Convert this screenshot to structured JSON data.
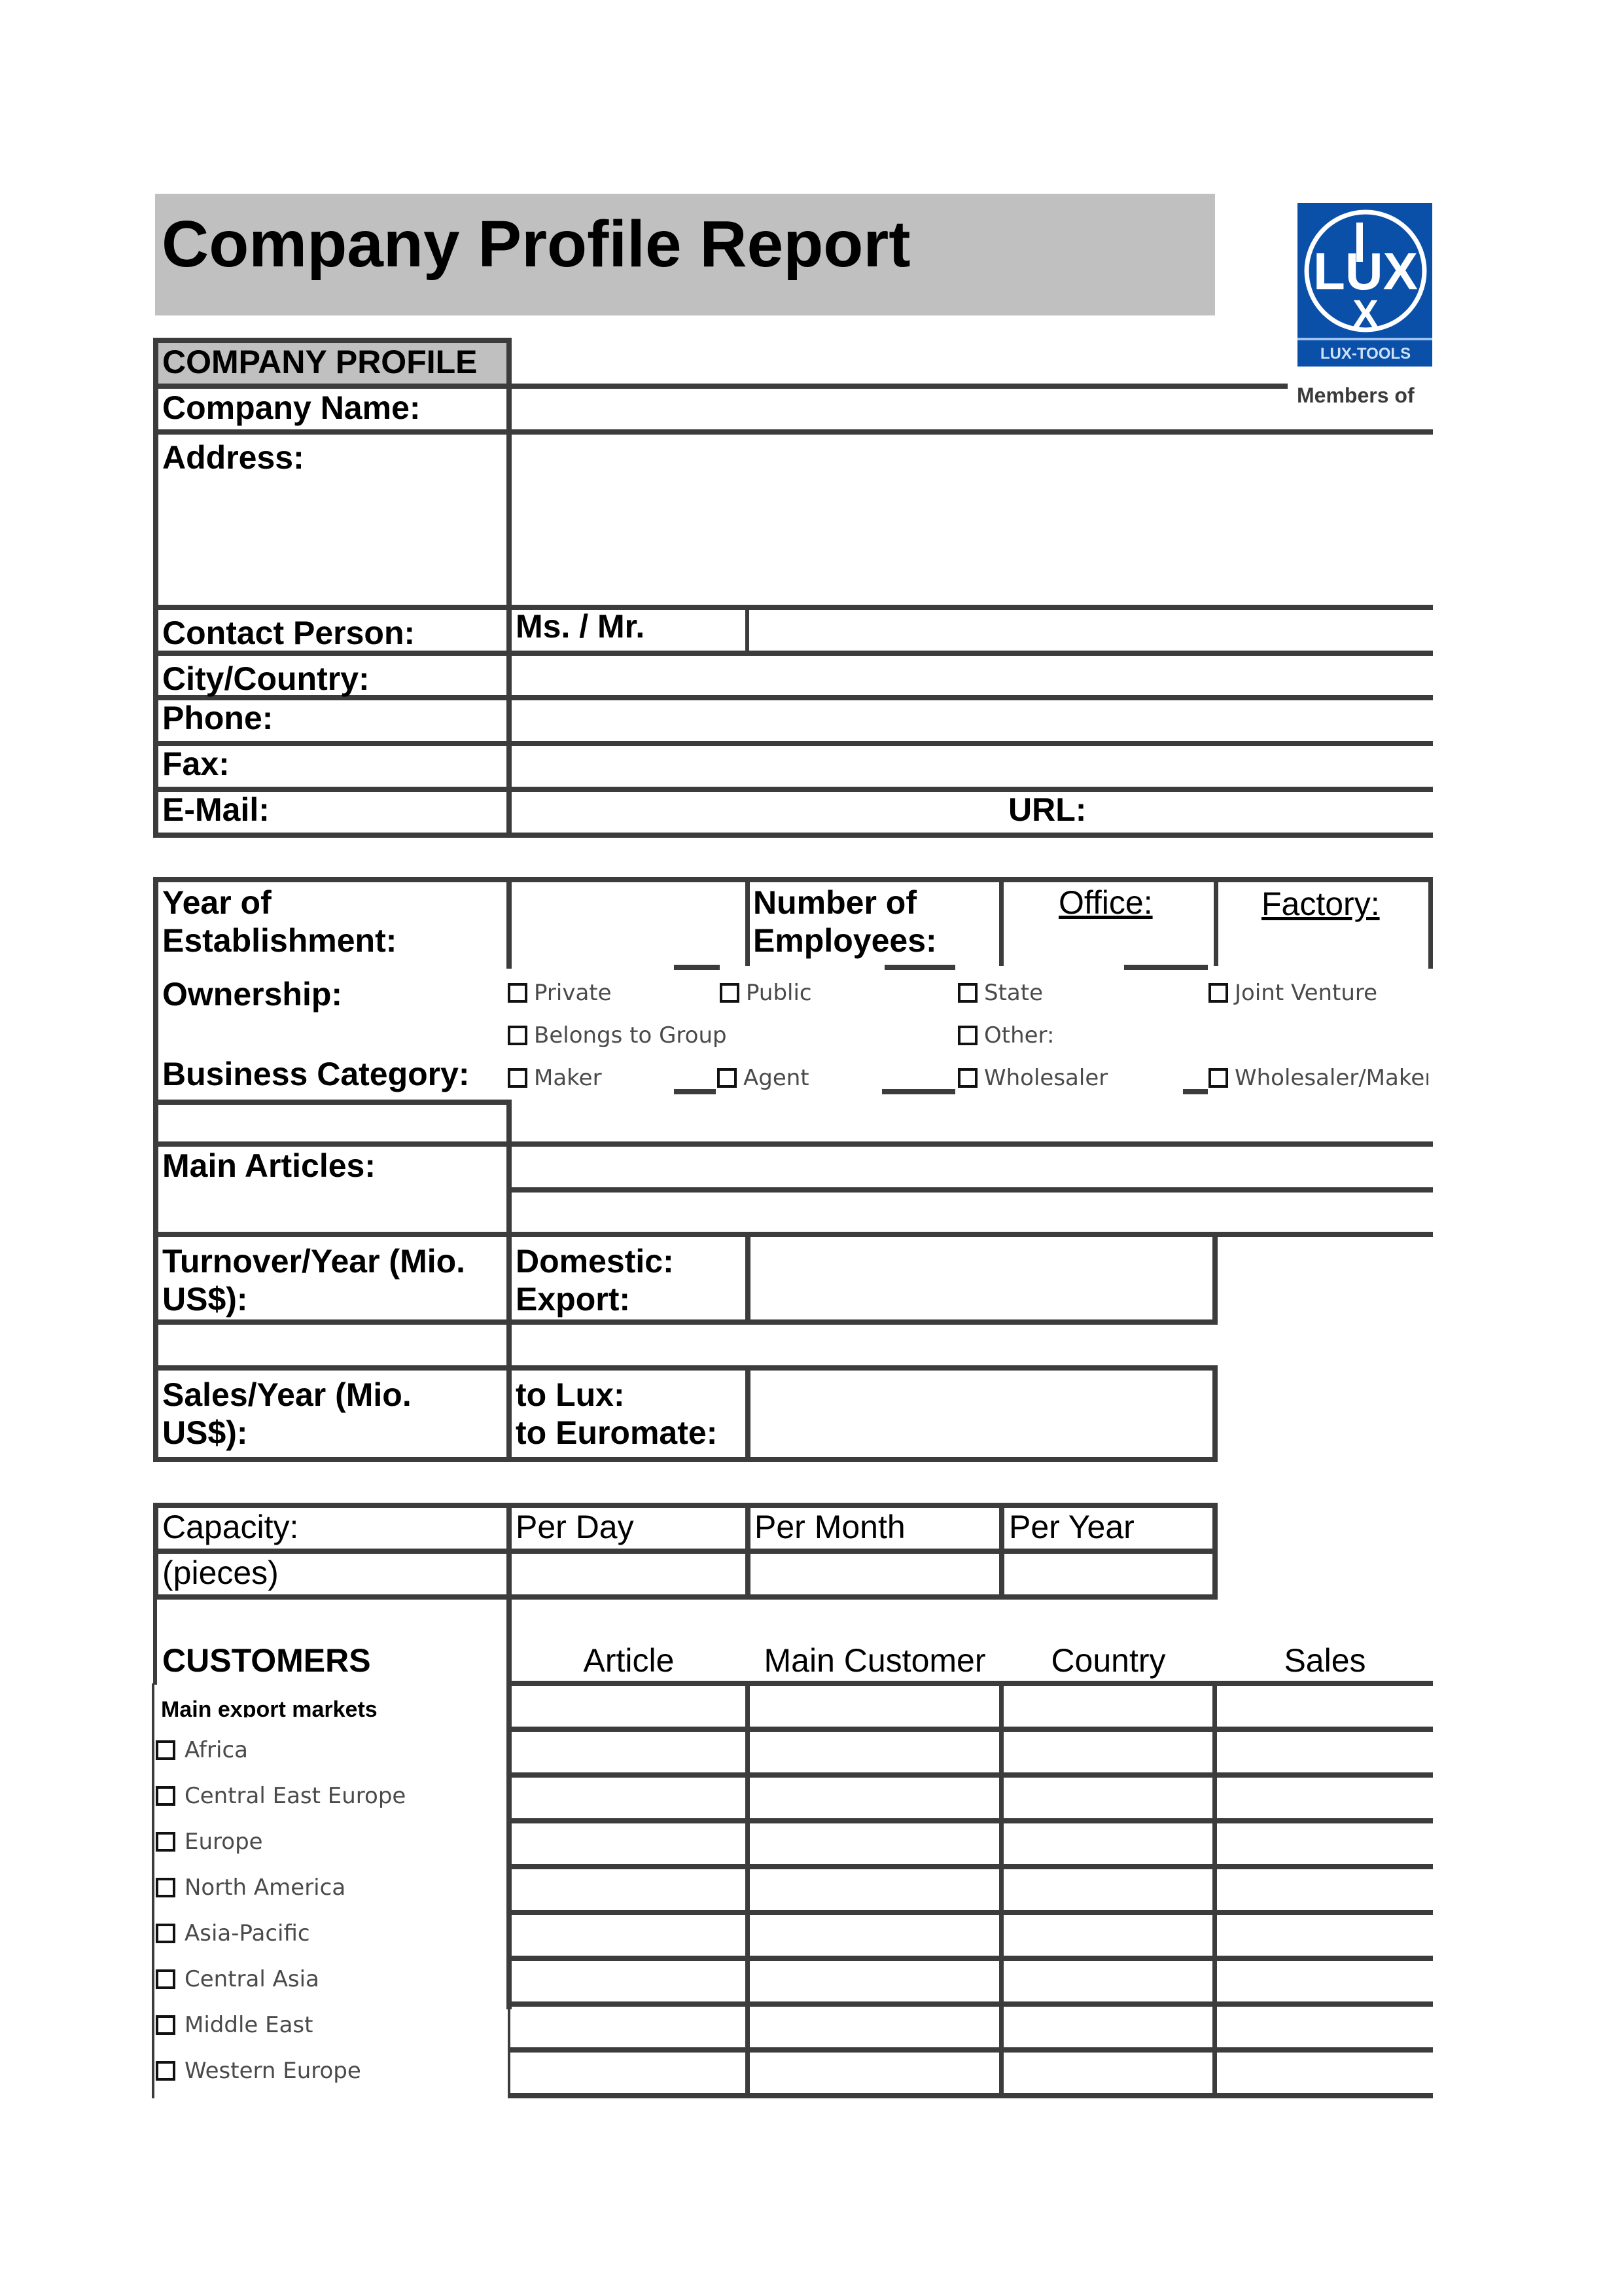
{
  "document": {
    "title": "Company Profile Report",
    "logo": {
      "name": "LUX-TOOLS",
      "caption": "Members of",
      "brand_color": "#0a4fa8"
    }
  },
  "company_profile": {
    "section_header": "COMPANY PROFILE",
    "fields": {
      "company_name": {
        "label": "Company Name:",
        "value": ""
      },
      "address": {
        "label": "Address:",
        "value": ""
      },
      "contact_person": {
        "label": "Contact Person:",
        "salutation": "Ms. / Mr.",
        "value": ""
      },
      "city_country": {
        "label": "City/Country:",
        "value": ""
      },
      "phone": {
        "label": "Phone:",
        "value": ""
      },
      "fax": {
        "label": "Fax:",
        "value": ""
      },
      "email": {
        "label": "E-Mail:",
        "value": ""
      },
      "url": {
        "label": "URL:",
        "value": ""
      }
    }
  },
  "business": {
    "year_of_establishment": {
      "label_line1": "Year of",
      "label_line2": "Establishment:",
      "value": ""
    },
    "employees": {
      "label_line1": "Number of",
      "label_line2": "Employees:",
      "office_label": "Office:",
      "factory_label": "Factory:",
      "office_value": "",
      "factory_value": ""
    },
    "ownership": {
      "label": "Ownership:",
      "options": [
        {
          "label": "Private",
          "checked": false
        },
        {
          "label": "Public",
          "checked": false
        },
        {
          "label": "State",
          "checked": false
        },
        {
          "label": "Joint Venture",
          "checked": false
        },
        {
          "label": "Belongs to Group",
          "checked": false
        },
        {
          "label": "Other:",
          "checked": false
        }
      ]
    },
    "business_category": {
      "label": "Business Category:",
      "options": [
        {
          "label": "Maker",
          "checked": false
        },
        {
          "label": "Agent",
          "checked": false
        },
        {
          "label": "Wholesaler",
          "checked": false
        },
        {
          "label": "Wholesaler/Maker",
          "checked": false
        }
      ]
    },
    "main_articles": {
      "label": "Main Articles:",
      "values": [
        "",
        ""
      ]
    }
  },
  "financials": {
    "turnover": {
      "label_line1": "Turnover/Year (Mio.",
      "label_line2": "US$):",
      "sub1": "Domestic:",
      "sub2": "Export:",
      "value": ""
    },
    "sales": {
      "label_line1": "Sales/Year (Mio.",
      "label_line2": "US$):",
      "sub1": "to Lux:",
      "sub2": "to Euromate:",
      "value": ""
    }
  },
  "capacity": {
    "label": "Capacity:",
    "unit": "(pieces)",
    "columns": [
      "Per Day",
      "Per Month",
      "Per Year"
    ],
    "values": [
      "",
      "",
      ""
    ]
  },
  "customers": {
    "header": "CUSTOMERS",
    "markets_label": "Main export markets",
    "markets": [
      {
        "label": "Africa",
        "checked": false
      },
      {
        "label": "Central East Europe",
        "checked": false
      },
      {
        "label": "Europe",
        "checked": false
      },
      {
        "label": "North America",
        "checked": false
      },
      {
        "label": "Asia-Pacific",
        "checked": false
      },
      {
        "label": "Central Asia",
        "checked": false
      },
      {
        "label": "Middle East",
        "checked": false
      },
      {
        "label": "Western Europe",
        "checked": false
      }
    ],
    "columns": [
      "Article",
      "Main Customer",
      "Country",
      "Sales"
    ],
    "row_count": 9
  }
}
